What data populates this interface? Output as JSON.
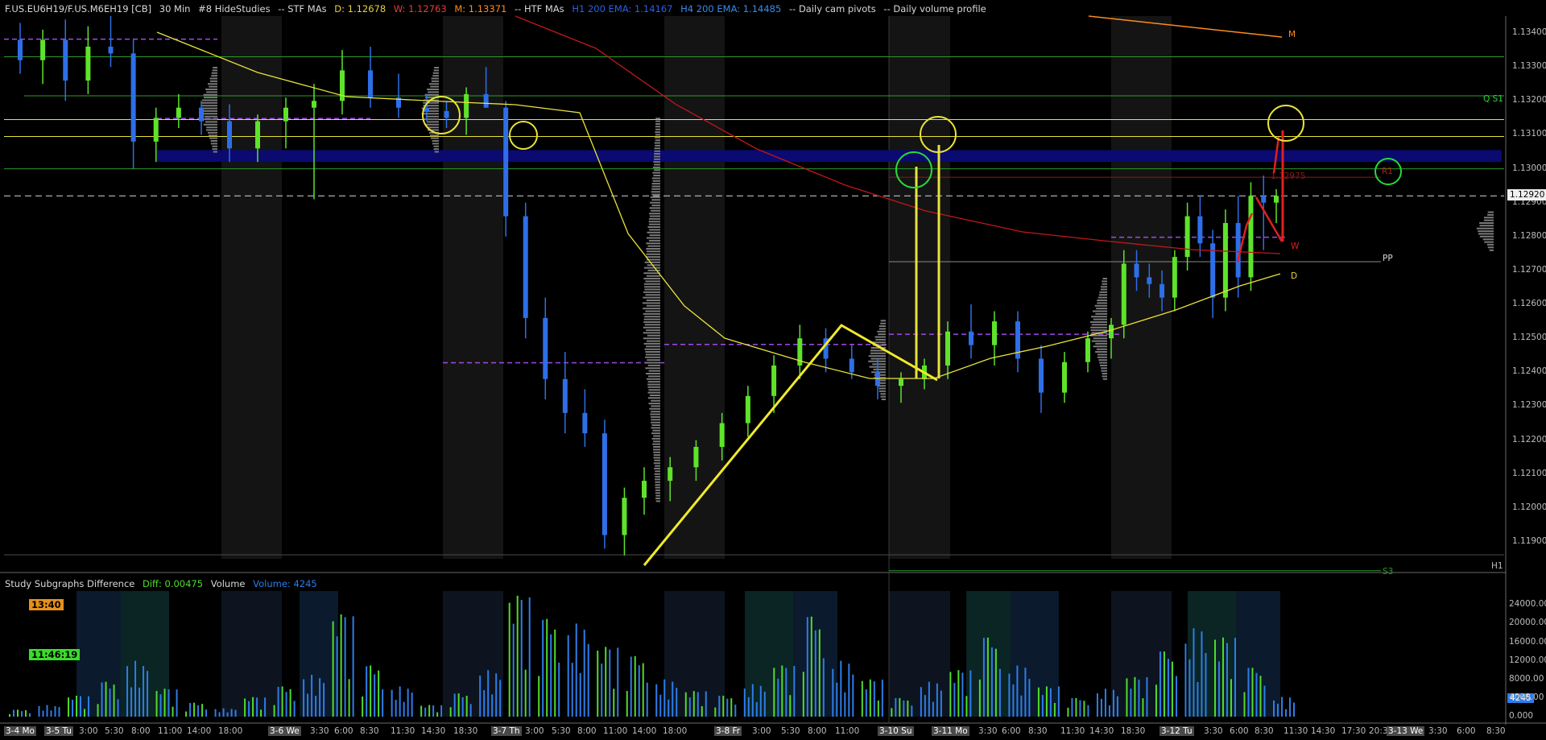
{
  "header": {
    "symbol": "F.US.EU6H19/F.US.M6EH19 [CB]",
    "timeframe": "30 Min",
    "study_set": "#8 HideStudies",
    "stf_mas": "-- STF MAs",
    "d_level": "D: 1.12678",
    "w_level": "W: 1.12763",
    "m_level": "M: 1.13371",
    "htf_mas": "-- HTF MAs",
    "h1_ema": "H1 200 EMA: 1.14167",
    "h4_ema": "H4 200 EMA: 1.14485",
    "daily_pivots": "-- Daily cam pivots",
    "daily_profile": "-- Daily volume profile"
  },
  "subgraph": {
    "title": "Study Subgraphs Difference",
    "diff": "Diff: 0.00475",
    "volume_label": "Volume",
    "volume_value": "Volume: 4245",
    "clock_orange": "13:40",
    "clock_green": "11:46:19",
    "current_volume_tag": "4245"
  },
  "colors": {
    "background": "#000000",
    "bull_candle": "#5ee32a",
    "bear_candle": "#2e6fe8",
    "vol_bull": "#4fdc2a",
    "vol_bear": "#2d7de8",
    "yellow": "#e8e23a",
    "red_ema": "#c01818",
    "orange": "#ff8c1a",
    "green_level": "#2d9a2d",
    "purple_poc": "#a04ae8",
    "value_area": "#0a0a70"
  },
  "price_axis": {
    "labels": [
      "1.13400",
      "1.13300",
      "1.13200",
      "1.13100",
      "1.13000",
      "1.12900",
      "1.12800",
      "1.12700",
      "1.12600",
      "1.12500",
      "1.12400",
      "1.12300",
      "1.12200",
      "1.12100",
      "1.12000",
      "1.11900"
    ],
    "values": [
      1.134,
      1.133,
      1.132,
      1.131,
      1.13,
      1.129,
      1.128,
      1.127,
      1.126,
      1.125,
      1.124,
      1.123,
      1.122,
      1.121,
      1.12,
      1.119
    ],
    "current_price": "1.12920",
    "current_price_value": 1.1292,
    "r1_tag": "1.12975",
    "r1_value": 1.12975
  },
  "volume_axis": {
    "labels": [
      "24000.00",
      "20000.00",
      "16000.00",
      "12000.00",
      "8000.00",
      "4000.00",
      "0.000"
    ],
    "values": [
      24000,
      20000,
      16000,
      12000,
      8000,
      4000,
      0
    ]
  },
  "time_axis": [
    {
      "label": "3-4 Mo",
      "boxed": true
    },
    {
      "label": "3-5 Tu",
      "boxed": true
    },
    {
      "label": "3:00"
    },
    {
      "label": "5:30"
    },
    {
      "label": "8:00"
    },
    {
      "label": "11:00"
    },
    {
      "label": "14:00"
    },
    {
      "label": "18:00"
    },
    {
      "label": "3-6 We",
      "boxed": true
    },
    {
      "label": "3:30"
    },
    {
      "label": "6:00"
    },
    {
      "label": "8:30"
    },
    {
      "label": "11:30"
    },
    {
      "label": "14:30"
    },
    {
      "label": "18:30"
    },
    {
      "label": "3-7 Th",
      "boxed": true
    },
    {
      "label": "3:00"
    },
    {
      "label": "5:30"
    },
    {
      "label": "8:00"
    },
    {
      "label": "11:00"
    },
    {
      "label": "14:00"
    },
    {
      "label": "18:00"
    },
    {
      "label": "3-8 Fr",
      "boxed": true
    },
    {
      "label": "3:00"
    },
    {
      "label": "5:30"
    },
    {
      "label": "8:00"
    },
    {
      "label": "11:00"
    },
    {
      "label": "3-10 Su",
      "boxed": true
    },
    {
      "label": "3-11 Mo",
      "boxed": true
    },
    {
      "label": "3:30"
    },
    {
      "label": "6:00"
    },
    {
      "label": "8:30"
    },
    {
      "label": "11:30"
    },
    {
      "label": "14:30"
    },
    {
      "label": "18:30"
    },
    {
      "label": "3-12 Tu",
      "boxed": true
    },
    {
      "label": "3:30"
    },
    {
      "label": "6:00"
    },
    {
      "label": "8:30"
    },
    {
      "label": "11:30"
    },
    {
      "label": "14:30"
    },
    {
      "label": "17:30"
    },
    {
      "label": "20:30"
    },
    {
      "label": "3-13 We",
      "boxed": true
    },
    {
      "label": "3:30"
    },
    {
      "label": "6:00"
    },
    {
      "label": "8:30"
    }
  ],
  "pivot_labels": {
    "m": "M",
    "w": "W",
    "d": "D",
    "pp": "PP",
    "r1": "R1",
    "s3": "S3",
    "q_s1": "Q S1",
    "h1": "H1"
  },
  "chart_data": {
    "type": "candlestick",
    "instrument": "F.US.EU6H19/F.US.M6EH19 [CB]",
    "timeframe": "30 Min",
    "price_range": [
      1.1185,
      1.1345
    ],
    "volume_range": [
      0,
      27000
    ],
    "levels": {
      "M": 1.13371,
      "W": 1.12763,
      "D": 1.12678,
      "PP": 1.12726,
      "R1": 1.12975,
      "Q S1": 1.13215,
      "S3": 1.11815,
      "current": 1.1292,
      "H1 200 EMA": 1.14167,
      "H4 200 EMA": 1.14485
    },
    "candles": [
      {
        "t": "3-4 18:00",
        "o": 1.1338,
        "h": 1.1343,
        "l": 1.1328,
        "c": 1.1332
      },
      {
        "t": "3-5 0:00",
        "o": 1.1332,
        "h": 1.1341,
        "l": 1.1325,
        "c": 1.1338
      },
      {
        "t": "3-5 3:00",
        "o": 1.1338,
        "h": 1.1344,
        "l": 1.132,
        "c": 1.1326
      },
      {
        "t": "3-5 6:00",
        "o": 1.1326,
        "h": 1.1342,
        "l": 1.1322,
        "c": 1.1336
      },
      {
        "t": "3-5 9:00",
        "o": 1.1336,
        "h": 1.1345,
        "l": 1.133,
        "c": 1.1334
      },
      {
        "t": "3-5 10:00",
        "o": 1.1334,
        "h": 1.1338,
        "l": 1.13,
        "c": 1.1308
      },
      {
        "t": "3-5 12:00",
        "o": 1.1308,
        "h": 1.1318,
        "l": 1.1302,
        "c": 1.1315
      },
      {
        "t": "3-5 14:00",
        "o": 1.1315,
        "h": 1.1322,
        "l": 1.1312,
        "c": 1.1318
      },
      {
        "t": "3-5 18:00",
        "o": 1.1318,
        "h": 1.132,
        "l": 1.131,
        "c": 1.1314
      },
      {
        "t": "3-6 3:00",
        "o": 1.1314,
        "h": 1.1319,
        "l": 1.1302,
        "c": 1.1306
      },
      {
        "t": "3-6 6:00",
        "o": 1.1306,
        "h": 1.1316,
        "l": 1.1302,
        "c": 1.1314
      },
      {
        "t": "3-6 9:00",
        "o": 1.1314,
        "h": 1.1321,
        "l": 1.1306,
        "c": 1.1318
      },
      {
        "t": "3-6 11:00",
        "o": 1.1318,
        "h": 1.1325,
        "l": 1.1291,
        "c": 1.132
      },
      {
        "t": "3-6 12:00",
        "o": 1.132,
        "h": 1.1335,
        "l": 1.1316,
        "c": 1.1329
      },
      {
        "t": "3-6 13:00",
        "o": 1.1329,
        "h": 1.1336,
        "l": 1.1318,
        "c": 1.1321
      },
      {
        "t": "3-6 15:00",
        "o": 1.1321,
        "h": 1.1328,
        "l": 1.1315,
        "c": 1.1318
      },
      {
        "t": "3-6 18:00",
        "o": 1.1318,
        "h": 1.1322,
        "l": 1.1314,
        "c": 1.1317
      },
      {
        "t": "3-7 2:00",
        "o": 1.1317,
        "h": 1.132,
        "l": 1.1312,
        "c": 1.1315
      },
      {
        "t": "3-7 5:00",
        "o": 1.1315,
        "h": 1.1324,
        "l": 1.131,
        "c": 1.1322
      },
      {
        "t": "3-7 7:00",
        "o": 1.1322,
        "h": 1.133,
        "l": 1.1318,
        "c": 1.1318
      },
      {
        "t": "3-7 8:30",
        "o": 1.1318,
        "h": 1.132,
        "l": 1.128,
        "c": 1.1286
      },
      {
        "t": "3-7 10:00",
        "o": 1.1286,
        "h": 1.129,
        "l": 1.125,
        "c": 1.1256
      },
      {
        "t": "3-7 11:00",
        "o": 1.1256,
        "h": 1.1262,
        "l": 1.1232,
        "c": 1.1238
      },
      {
        "t": "3-7 12:00",
        "o": 1.1238,
        "h": 1.1246,
        "l": 1.1222,
        "c": 1.1228
      },
      {
        "t": "3-7 13:00",
        "o": 1.1228,
        "h": 1.1235,
        "l": 1.1218,
        "c": 1.1222
      },
      {
        "t": "3-7 14:00",
        "o": 1.1222,
        "h": 1.1226,
        "l": 1.1188,
        "c": 1.1192
      },
      {
        "t": "3-7 16:00",
        "o": 1.1192,
        "h": 1.1206,
        "l": 1.1186,
        "c": 1.1203
      },
      {
        "t": "3-7 18:00",
        "o": 1.1203,
        "h": 1.1212,
        "l": 1.1198,
        "c": 1.1208
      },
      {
        "t": "3-8 2:00",
        "o": 1.1208,
        "h": 1.1215,
        "l": 1.1202,
        "c": 1.1212
      },
      {
        "t": "3-8 4:00",
        "o": 1.1212,
        "h": 1.122,
        "l": 1.1208,
        "c": 1.1218
      },
      {
        "t": "3-8 6:00",
        "o": 1.1218,
        "h": 1.1228,
        "l": 1.1214,
        "c": 1.1225
      },
      {
        "t": "3-8 8:00",
        "o": 1.1225,
        "h": 1.1236,
        "l": 1.1221,
        "c": 1.1233
      },
      {
        "t": "3-8 9:00",
        "o": 1.1233,
        "h": 1.1245,
        "l": 1.1228,
        "c": 1.1242
      },
      {
        "t": "3-8 10:30",
        "o": 1.1242,
        "h": 1.1254,
        "l": 1.1238,
        "c": 1.125
      },
      {
        "t": "3-8 12:00",
        "o": 1.125,
        "h": 1.1253,
        "l": 1.124,
        "c": 1.1244
      },
      {
        "t": "3-8 14:00",
        "o": 1.1244,
        "h": 1.1248,
        "l": 1.1238,
        "c": 1.124
      },
      {
        "t": "3-10 Su",
        "o": 1.124,
        "h": 1.1244,
        "l": 1.1232,
        "c": 1.1236
      },
      {
        "t": "3-11 2:00",
        "o": 1.1236,
        "h": 1.124,
        "l": 1.1231,
        "c": 1.1238
      },
      {
        "t": "3-11 3:30",
        "o": 1.1238,
        "h": 1.1244,
        "l": 1.1235,
        "c": 1.1242
      },
      {
        "t": "3-11 5:00",
        "o": 1.1242,
        "h": 1.1255,
        "l": 1.1238,
        "c": 1.1252
      },
      {
        "t": "3-11 6:30",
        "o": 1.1252,
        "h": 1.126,
        "l": 1.1244,
        "c": 1.1248
      },
      {
        "t": "3-11 8:30",
        "o": 1.1248,
        "h": 1.1258,
        "l": 1.1242,
        "c": 1.1255
      },
      {
        "t": "3-11 10:00",
        "o": 1.1255,
        "h": 1.1258,
        "l": 1.124,
        "c": 1.1244
      },
      {
        "t": "3-11 11:30",
        "o": 1.1244,
        "h": 1.1248,
        "l": 1.1228,
        "c": 1.1234
      },
      {
        "t": "3-11 13:00",
        "o": 1.1234,
        "h": 1.1246,
        "l": 1.1231,
        "c": 1.1243
      },
      {
        "t": "3-11 14:30",
        "o": 1.1243,
        "h": 1.1252,
        "l": 1.124,
        "c": 1.125
      },
      {
        "t": "3-11 16:00",
        "o": 1.125,
        "h": 1.1256,
        "l": 1.1244,
        "c": 1.1254
      },
      {
        "t": "3-11 18:30",
        "o": 1.1254,
        "h": 1.1276,
        "l": 1.125,
        "c": 1.1272
      },
      {
        "t": "3-11 21:00",
        "o": 1.1272,
        "h": 1.1276,
        "l": 1.1264,
        "c": 1.1268
      },
      {
        "t": "3-12 0:30",
        "o": 1.1268,
        "h": 1.1272,
        "l": 1.1262,
        "c": 1.1266
      },
      {
        "t": "3-12 3:30",
        "o": 1.1266,
        "h": 1.127,
        "l": 1.1258,
        "c": 1.1262
      },
      {
        "t": "3-12 5:00",
        "o": 1.1262,
        "h": 1.1276,
        "l": 1.1258,
        "c": 1.1274
      },
      {
        "t": "3-12 6:00",
        "o": 1.1274,
        "h": 1.129,
        "l": 1.127,
        "c": 1.1286
      },
      {
        "t": "3-12 7:00",
        "o": 1.1286,
        "h": 1.1292,
        "l": 1.1274,
        "c": 1.1278
      },
      {
        "t": "3-12 8:00",
        "o": 1.1278,
        "h": 1.1282,
        "l": 1.1256,
        "c": 1.1262
      },
      {
        "t": "3-12 8:30",
        "o": 1.1262,
        "h": 1.1288,
        "l": 1.1258,
        "c": 1.1284
      },
      {
        "t": "3-12 9:30",
        "o": 1.1284,
        "h": 1.1292,
        "l": 1.1262,
        "c": 1.1268
      },
      {
        "t": "3-12 10:30",
        "o": 1.1268,
        "h": 1.1296,
        "l": 1.1264,
        "c": 1.1292
      },
      {
        "t": "3-12 11:00",
        "o": 1.1292,
        "h": 1.1298,
        "l": 1.1276,
        "c": 1.129
      },
      {
        "t": "3-12 11:30",
        "o": 1.129,
        "h": 1.1294,
        "l": 1.1284,
        "c": 1.1292
      }
    ],
    "volume_bars": [
      {
        "t": "3-4",
        "v": 1500
      },
      {
        "t": "3-5 0:00",
        "v": 2500
      },
      {
        "t": "3-5 3:00",
        "v": 4500
      },
      {
        "t": "3-5 6:00",
        "v": 7500
      },
      {
        "t": "3-5 9:00",
        "v": 12000
      },
      {
        "t": "3-5 12:00",
        "v": 6000
      },
      {
        "t": "3-5 15:00",
        "v": 3000
      },
      {
        "t": "3-5 18:00",
        "v": 1800
      },
      {
        "t": "3-6 3:00",
        "v": 4200
      },
      {
        "t": "3-6 6:00",
        "v": 6500
      },
      {
        "t": "3-6 9:00",
        "v": 9000
      },
      {
        "t": "3-6 11:00",
        "v": 22000
      },
      {
        "t": "3-6 13:00",
        "v": 11000
      },
      {
        "t": "3-6 15:00",
        "v": 6500
      },
      {
        "t": "3-6 18:00",
        "v": 2500
      },
      {
        "t": "3-7 3:00",
        "v": 5000
      },
      {
        "t": "3-7 6:00",
        "v": 10000
      },
      {
        "t": "3-7 7:30",
        "v": 26000
      },
      {
        "t": "3-7 8:30",
        "v": 21000
      },
      {
        "t": "3-7 10:00",
        "v": 20000
      },
      {
        "t": "3-7 11:00",
        "v": 15000
      },
      {
        "t": "3-7 12:30",
        "v": 13000
      },
      {
        "t": "3-7 14:00",
        "v": 8000
      },
      {
        "t": "3-7 16:00",
        "v": 5500
      },
      {
        "t": "3-8 3:00",
        "v": 4500
      },
      {
        "t": "3-8 6:00",
        "v": 7000
      },
      {
        "t": "3-8 8:30",
        "v": 11000
      },
      {
        "t": "3-8 9:30",
        "v": 21500
      },
      {
        "t": "3-8 11:00",
        "v": 12000
      },
      {
        "t": "3-8 13:00",
        "v": 8000
      },
      {
        "t": "3-11 3:30",
        "v": 4000
      },
      {
        "t": "3-11 6:00",
        "v": 7500
      },
      {
        "t": "3-11 8:30",
        "v": 10000
      },
      {
        "t": "3-11 10:00",
        "v": 17000
      },
      {
        "t": "3-11 11:30",
        "v": 11000
      },
      {
        "t": "3-11 14:30",
        "v": 6500
      },
      {
        "t": "3-11 18:30",
        "v": 4000
      },
      {
        "t": "3-12 3:30",
        "v": 6000
      },
      {
        "t": "3-12 6:00",
        "v": 8500
      },
      {
        "t": "3-12 7:00",
        "v": 14000
      },
      {
        "t": "3-12 8:30",
        "v": 19000
      },
      {
        "t": "3-12 9:30",
        "v": 17000
      },
      {
        "t": "3-12 10:30",
        "v": 10500
      },
      {
        "t": "3-12 11:30",
        "v": 4245
      }
    ],
    "subgraph_diff": 0.00475,
    "current_volume": 4245
  }
}
